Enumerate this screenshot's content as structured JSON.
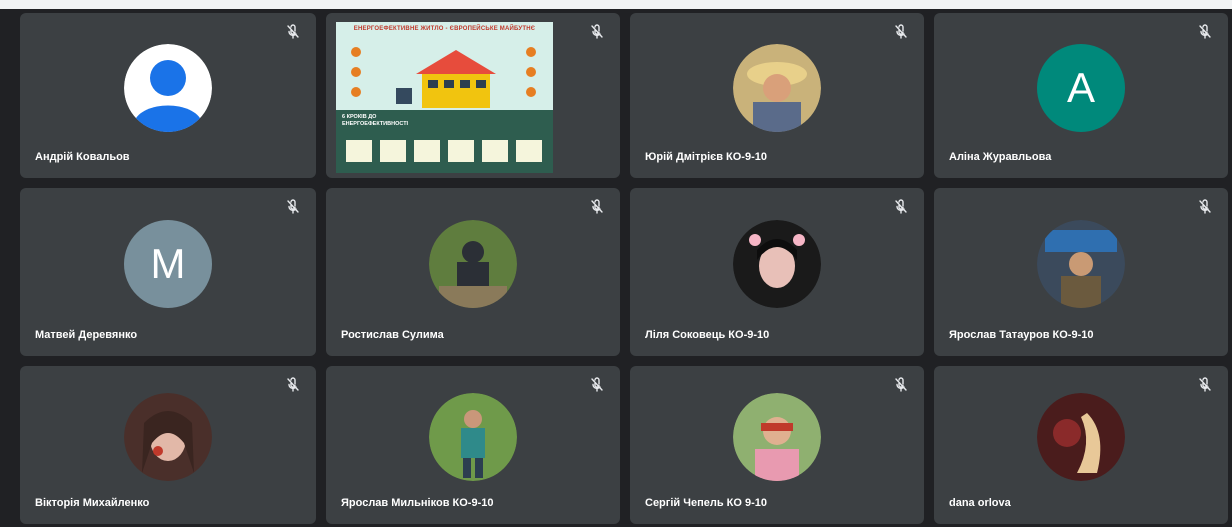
{
  "participants": [
    {
      "name": "Андрій Ковальов",
      "avatar_type": "default",
      "muted": true
    },
    {
      "name": "",
      "avatar_type": "presentation",
      "muted": true
    },
    {
      "name": "Юрій Дмітрієв КО-9-10",
      "avatar_type": "photo",
      "muted": true
    },
    {
      "name": "Аліна Журавльова",
      "avatar_type": "letter",
      "letter": "A",
      "color": "#00897b",
      "muted": true
    },
    {
      "name": "Матвей Деревянко",
      "avatar_type": "letter",
      "letter": "M",
      "color": "#78909c",
      "muted": true
    },
    {
      "name": "Ростислав Сулима",
      "avatar_type": "photo",
      "muted": true
    },
    {
      "name": "Ліля Соковець КО-9-10",
      "avatar_type": "photo",
      "muted": true
    },
    {
      "name": "Ярослав Татауров КО-9-10",
      "avatar_type": "photo",
      "muted": true
    },
    {
      "name": "Вікторія Михайленко",
      "avatar_type": "photo",
      "muted": true
    },
    {
      "name": "Ярослав Мильніков КО-9-10",
      "avatar_type": "photo",
      "muted": true
    },
    {
      "name": "Сергій Чепель КО 9-10",
      "avatar_type": "photo",
      "muted": true
    },
    {
      "name": "dana orlova",
      "avatar_type": "photo",
      "muted": true
    }
  ],
  "presentation": {
    "title": "ЕНЕРГОЕФЕКТИВНЕ ЖИТЛО - ЄВРОПЕЙСЬКЕ МАЙБУТНЄ",
    "subtitle": "6 КРОКІВ ДО ЕНЕРГОЕФЕКТИВНОСТІ"
  },
  "icons": {
    "mute": "mic-off-icon"
  },
  "colors": {
    "background": "#202124",
    "tile": "#3c4043"
  }
}
